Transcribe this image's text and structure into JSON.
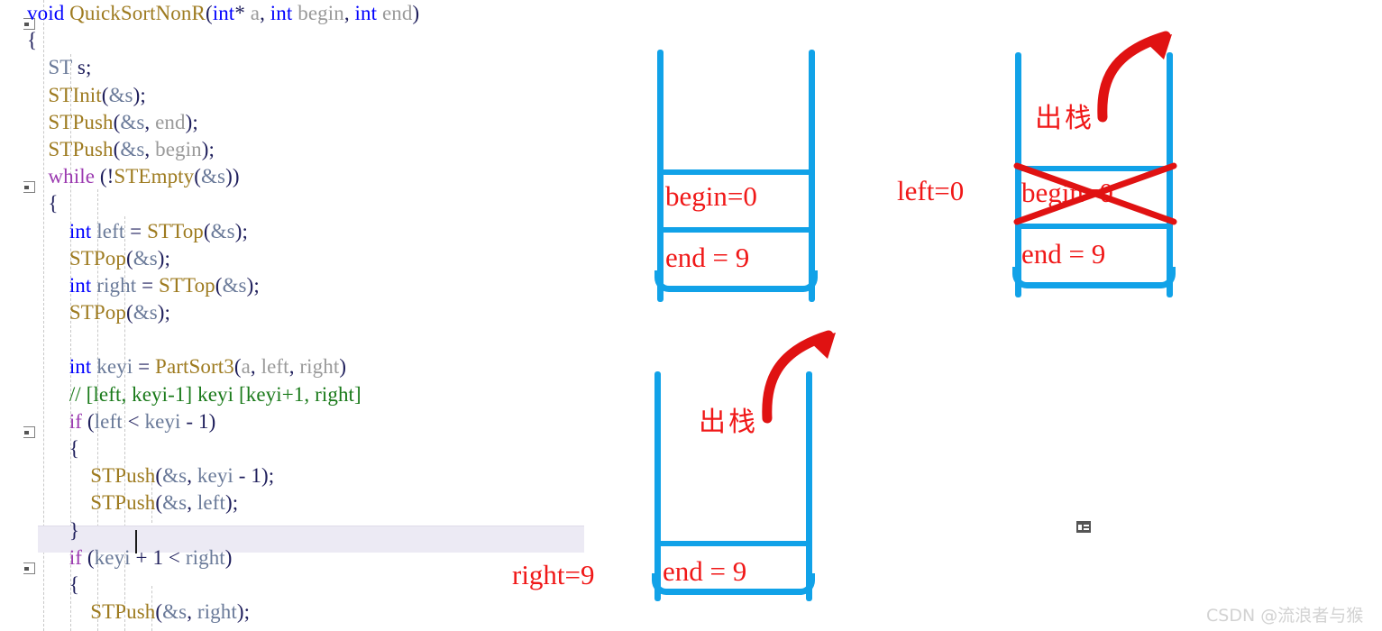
{
  "editor": {
    "language": "c",
    "lines": [
      {
        "indent": 0,
        "fold": true,
        "tokens": [
          {
            "t": "void ",
            "c": "kw"
          },
          {
            "t": "QuickSortNonR",
            "c": "fn"
          },
          {
            "t": "(",
            "c": "punc"
          },
          {
            "t": "int",
            "c": "kw"
          },
          {
            "t": "* ",
            "c": "punc"
          },
          {
            "t": "a",
            "c": "gy"
          },
          {
            "t": ", ",
            "c": "punc"
          },
          {
            "t": "int",
            "c": "kw"
          },
          {
            "t": " begin",
            "c": "gy"
          },
          {
            "t": ", ",
            "c": "punc"
          },
          {
            "t": "int",
            "c": "kw"
          },
          {
            "t": " end",
            "c": "gy"
          },
          {
            "t": ")",
            "c": "punc"
          }
        ]
      },
      {
        "indent": 0,
        "fold": false,
        "tokens": [
          {
            "t": "{",
            "c": "punc"
          }
        ]
      },
      {
        "indent": 1,
        "fold": false,
        "tokens": [
          {
            "t": "ST",
            "c": "id"
          },
          {
            "t": " s;",
            "c": "punc"
          }
        ]
      },
      {
        "indent": 1,
        "fold": false,
        "tokens": [
          {
            "t": "STInit",
            "c": "fn"
          },
          {
            "t": "(",
            "c": "punc"
          },
          {
            "t": "&s",
            "c": "id"
          },
          {
            "t": ");",
            "c": "punc"
          }
        ]
      },
      {
        "indent": 1,
        "fold": false,
        "tokens": [
          {
            "t": "STPush",
            "c": "fn"
          },
          {
            "t": "(",
            "c": "punc"
          },
          {
            "t": "&s",
            "c": "id"
          },
          {
            "t": ", ",
            "c": "punc"
          },
          {
            "t": "end",
            "c": "gy"
          },
          {
            "t": ");",
            "c": "punc"
          }
        ]
      },
      {
        "indent": 1,
        "fold": false,
        "tokens": [
          {
            "t": "STPush",
            "c": "fn"
          },
          {
            "t": "(",
            "c": "punc"
          },
          {
            "t": "&s",
            "c": "id"
          },
          {
            "t": ", ",
            "c": "punc"
          },
          {
            "t": "begin",
            "c": "gy"
          },
          {
            "t": ");",
            "c": "punc"
          }
        ]
      },
      {
        "indent": 1,
        "fold": true,
        "tokens": [
          {
            "t": "while",
            "c": "kw2"
          },
          {
            "t": " (!",
            "c": "punc"
          },
          {
            "t": "STEmpty",
            "c": "fn"
          },
          {
            "t": "(",
            "c": "punc"
          },
          {
            "t": "&s",
            "c": "id"
          },
          {
            "t": "))",
            "c": "punc"
          }
        ]
      },
      {
        "indent": 1,
        "fold": false,
        "tokens": [
          {
            "t": "{",
            "c": "punc"
          }
        ]
      },
      {
        "indent": 2,
        "fold": false,
        "tokens": [
          {
            "t": "int",
            "c": "kw"
          },
          {
            "t": " ",
            "c": "punc"
          },
          {
            "t": "left",
            "c": "id"
          },
          {
            "t": " = ",
            "c": "punc"
          },
          {
            "t": "STTop",
            "c": "fn"
          },
          {
            "t": "(",
            "c": "punc"
          },
          {
            "t": "&s",
            "c": "id"
          },
          {
            "t": ");",
            "c": "punc"
          }
        ]
      },
      {
        "indent": 2,
        "fold": false,
        "tokens": [
          {
            "t": "STPop",
            "c": "fn"
          },
          {
            "t": "(",
            "c": "punc"
          },
          {
            "t": "&s",
            "c": "id"
          },
          {
            "t": ");",
            "c": "punc"
          }
        ]
      },
      {
        "indent": 2,
        "fold": false,
        "tokens": [
          {
            "t": "int",
            "c": "kw"
          },
          {
            "t": " ",
            "c": "punc"
          },
          {
            "t": "right",
            "c": "id"
          },
          {
            "t": " = ",
            "c": "punc"
          },
          {
            "t": "STTop",
            "c": "fn"
          },
          {
            "t": "(",
            "c": "punc"
          },
          {
            "t": "&s",
            "c": "id"
          },
          {
            "t": ");",
            "c": "punc"
          }
        ]
      },
      {
        "indent": 2,
        "fold": false,
        "tokens": [
          {
            "t": "STPop",
            "c": "fn"
          },
          {
            "t": "(",
            "c": "punc"
          },
          {
            "t": "&s",
            "c": "id"
          },
          {
            "t": ");",
            "c": "punc"
          }
        ]
      },
      {
        "indent": 2,
        "fold": false,
        "tokens": []
      },
      {
        "indent": 2,
        "fold": false,
        "tokens": [
          {
            "t": "int",
            "c": "kw"
          },
          {
            "t": " ",
            "c": "punc"
          },
          {
            "t": "keyi",
            "c": "id"
          },
          {
            "t": " = ",
            "c": "punc"
          },
          {
            "t": "PartSort3",
            "c": "fn"
          },
          {
            "t": "(",
            "c": "punc"
          },
          {
            "t": "a",
            "c": "gy"
          },
          {
            "t": ", ",
            "c": "punc"
          },
          {
            "t": "left",
            "c": "gy"
          },
          {
            "t": ", ",
            "c": "punc"
          },
          {
            "t": "right",
            "c": "gy"
          },
          {
            "t": ")",
            "c": "punc"
          }
        ]
      },
      {
        "indent": 2,
        "fold": false,
        "tokens": [
          {
            "t": "// [left, keyi-1] keyi [keyi+1, right]",
            "c": "cm"
          }
        ]
      },
      {
        "indent": 2,
        "fold": true,
        "tokens": [
          {
            "t": "if",
            "c": "kw2"
          },
          {
            "t": " (",
            "c": "punc"
          },
          {
            "t": "left",
            "c": "id"
          },
          {
            "t": " < ",
            "c": "punc"
          },
          {
            "t": "keyi",
            "c": "id"
          },
          {
            "t": " - ",
            "c": "punc"
          },
          {
            "t": "1",
            "c": "pl"
          },
          {
            "t": ")",
            "c": "punc"
          }
        ]
      },
      {
        "indent": 2,
        "fold": false,
        "tokens": [
          {
            "t": "{",
            "c": "punc"
          }
        ]
      },
      {
        "indent": 3,
        "fold": false,
        "tokens": [
          {
            "t": "STPush",
            "c": "fn"
          },
          {
            "t": "(",
            "c": "punc"
          },
          {
            "t": "&s",
            "c": "id"
          },
          {
            "t": ", ",
            "c": "punc"
          },
          {
            "t": "keyi",
            "c": "id"
          },
          {
            "t": " - ",
            "c": "punc"
          },
          {
            "t": "1",
            "c": "pl"
          },
          {
            "t": ");",
            "c": "punc"
          }
        ]
      },
      {
        "indent": 3,
        "fold": false,
        "tokens": [
          {
            "t": "STPush",
            "c": "fn"
          },
          {
            "t": "(",
            "c": "punc"
          },
          {
            "t": "&s",
            "c": "id"
          },
          {
            "t": ", ",
            "c": "punc"
          },
          {
            "t": "left",
            "c": "id"
          },
          {
            "t": ");",
            "c": "punc"
          }
        ]
      },
      {
        "indent": 2,
        "fold": false,
        "tokens": [
          {
            "t": "}",
            "c": "punc"
          }
        ]
      },
      {
        "indent": 2,
        "fold": true,
        "tokens": [
          {
            "t": "if",
            "c": "kw2"
          },
          {
            "t": " (",
            "c": "punc"
          },
          {
            "t": "keyi",
            "c": "id"
          },
          {
            "t": " + ",
            "c": "punc"
          },
          {
            "t": "1",
            "c": "pl"
          },
          {
            "t": " < ",
            "c": "punc"
          },
          {
            "t": "right",
            "c": "id"
          },
          {
            "t": ")",
            "c": "punc"
          }
        ]
      },
      {
        "indent": 2,
        "fold": false,
        "tokens": [
          {
            "t": "{",
            "c": "punc"
          }
        ]
      },
      {
        "indent": 3,
        "fold": false,
        "tokens": [
          {
            "t": "STPush",
            "c": "fn"
          },
          {
            "t": "(",
            "c": "punc"
          },
          {
            "t": "&s",
            "c": "id"
          },
          {
            "t": ", ",
            "c": "punc"
          },
          {
            "t": "right",
            "c": "id"
          },
          {
            "t": ");",
            "c": "punc"
          }
        ]
      }
    ],
    "caret_line_text": "}"
  },
  "diagram": {
    "stacks": [
      {
        "id": "stack-initial",
        "cells": [
          {
            "label": "begin=0"
          },
          {
            "label": "end = 9"
          }
        ],
        "crossed": [],
        "pop_label": "",
        "side_label": ""
      },
      {
        "id": "stack-after-pop-left",
        "cells": [
          {
            "label": "begin=0"
          },
          {
            "label": "end = 9"
          }
        ],
        "crossed": [
          "begin=0"
        ],
        "pop_label": "出栈",
        "side_label": "left=0"
      },
      {
        "id": "stack-after-pop-right",
        "cells": [
          {
            "label": "end = 9"
          }
        ],
        "crossed": [],
        "pop_label": "出栈",
        "side_label": "right=9"
      }
    ],
    "colors": {
      "stack_outline": "#11a2e8",
      "annotation": "#f01818",
      "cross_out": "#e01212"
    }
  },
  "watermark": {
    "text": "CSDN @流浪者与猴"
  },
  "status": {
    "panel_icon": "panel-icon"
  }
}
